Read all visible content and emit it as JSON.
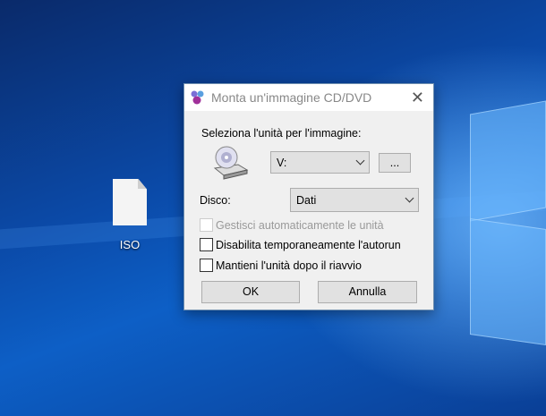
{
  "desktop": {
    "icons": [
      {
        "label": "ISO",
        "icon": "file-icon"
      }
    ]
  },
  "dialog": {
    "title": "Monta un'immagine CD/DVD",
    "select_drive_label": "Seleziona l'unità per l'immagine:",
    "drive_value": "V:",
    "browse_label": "...",
    "disc_label": "Disco:",
    "disc_value": "Dati",
    "checkboxes": [
      {
        "label": "Gestisci automaticamente le unità",
        "checked": false,
        "disabled": true
      },
      {
        "label": "Disabilita temporaneamente l'autorun",
        "checked": false,
        "disabled": false
      },
      {
        "label": "Mantieni l'unità dopo il riavvio",
        "checked": false,
        "disabled": false
      }
    ],
    "ok_label": "OK",
    "cancel_label": "Annulla"
  }
}
